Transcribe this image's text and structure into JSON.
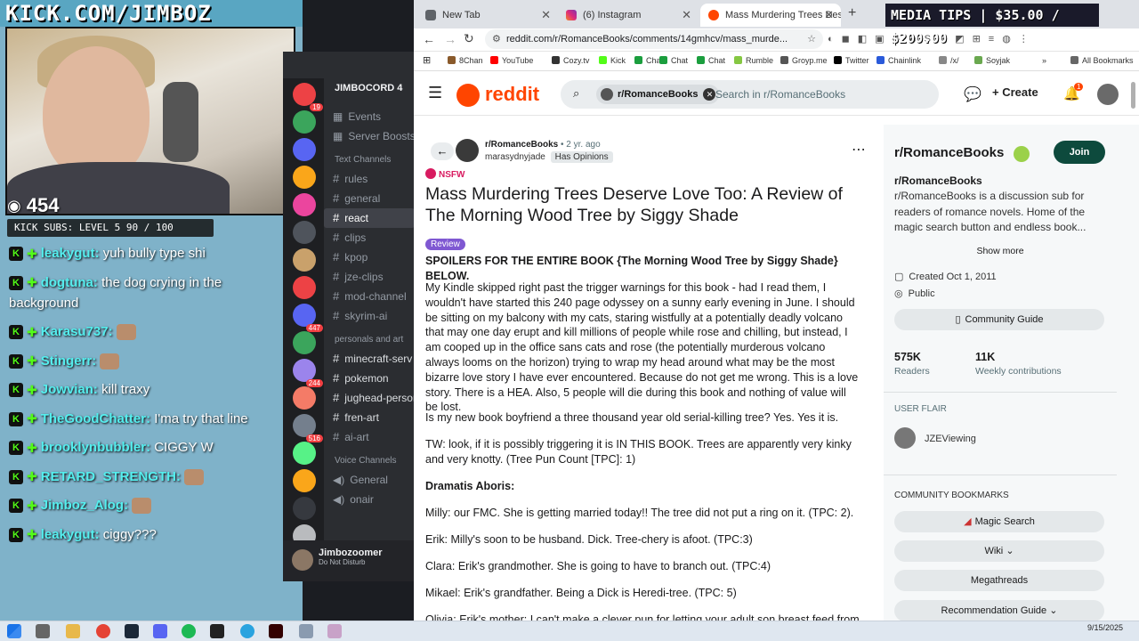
{
  "stream": {
    "url": "KICK.COM/JIMBOZ",
    "viewers": "454",
    "kick_subs": "KICK SUBS: LEVEL 5 90 / 100",
    "chat": [
      {
        "user": "leakygut:",
        "text": "yuh bully type shi"
      },
      {
        "user": "dogtuna:",
        "text": "the dog crying in the background"
      },
      {
        "user": "Karasu737:",
        "text": ""
      },
      {
        "user": "Stingerr:",
        "text": ""
      },
      {
        "user": "Jowvian:",
        "text": "kill traxy"
      },
      {
        "user": "TheGoodChatter:",
        "text": "I'ma try that line"
      },
      {
        "user": "brooklynbubbler:",
        "text": "CIGGY W"
      },
      {
        "user": "RETARD_STRENGTH:",
        "text": ""
      },
      {
        "user": "Jimboz_Alog:",
        "text": ""
      },
      {
        "user": "leakygut:",
        "text": "ciggy???"
      }
    ]
  },
  "discord": {
    "guild": "JIMBOCORD 4",
    "top_items": [
      "Events",
      "Server Boosts"
    ],
    "category_text": "Text Channels",
    "text_channels": [
      "rules",
      "general",
      "react",
      "clips",
      "kpop",
      "jze-clips",
      "mod-channel",
      "skyrim-ai"
    ],
    "active_channel": "react",
    "category_personal": "personals and art",
    "personal_channels": [
      "minecraft-serv",
      "pokemon",
      "jughead-person",
      "fren-art",
      "ai-art"
    ],
    "category_voice": "Voice Channels",
    "voice_channels": [
      "General",
      "onair"
    ],
    "server_counts": [
      "19",
      "447",
      "244",
      "516"
    ],
    "user_name": "Jimbozoomer",
    "user_status": "Do Not Disturb"
  },
  "browser": {
    "tabs": [
      {
        "label": "New Tab"
      },
      {
        "label": "(6) Instagram"
      },
      {
        "label": "Mass Murdering Trees Deserve"
      }
    ],
    "media_tips": "MEDIA TIPS | $35.00 / $200.00",
    "url": "reddit.com/r/RomanceBooks/comments/14gmhcv/mass_murde...",
    "bookmarks": [
      "8Chan",
      "YouTube",
      "Cozy.tv",
      "Kick",
      "Chat",
      "Chat",
      "Chat",
      "Rumble",
      "Groyp.me",
      "Twitter",
      "Chainlink",
      "/x/",
      "Soyjak",
      "All Bookmarks"
    ],
    "bookmark_colors": [
      "#8a5a2b",
      "#ff0000",
      "#333333",
      "#53fc18",
      "#1b9e3e",
      "#1b9e3e",
      "#1b9e3e",
      "#85c742",
      "#555555",
      "#000000",
      "#2a5ada",
      "#888888",
      "#6aa84f",
      "#666666"
    ]
  },
  "reddit": {
    "logo": "reddit",
    "search_chip": "r/RomanceBooks",
    "search_placeholder": "Search in r/RomanceBooks",
    "create": "Create",
    "notifications": "1",
    "subreddit": "r/RomanceBooks",
    "time": "• 2 yr. ago",
    "author": "marasydnyjade",
    "author_flair": "Has Opinions",
    "nsfw": "NSFW",
    "title": "Mass Murdering Trees Deserve Love Too: A Review of The Morning Wood Tree by Siggy Shade",
    "flair": "Review",
    "paragraphs": [
      "SPOILERS FOR THE ENTIRE BOOK {The Morning Wood Tree by Siggy Shade} BELOW.",
      "My Kindle skipped right past the trigger warnings for this book - had I read them, I wouldn't have started this 240 page odyssey on a sunny early evening in June. I should be sitting on my balcony with my cats, staring wistfully at a potentially deadly volcano that may one day erupt and kill millions of people while rose and chilling, but instead, I am cooped up in the office sans cats and rose (the potentially murderous volcano always looms on the horizon) trying to wrap my head around what may be the most bizarre love story I have ever encountered. Because do not get me wrong. This is a love story. There is a HEA. Also, 5 people will die during this book and nothing of value will be lost.",
      "Is my new book boyfriend a three thousand year old serial-killing tree? Yes. Yes it is.",
      "TW: look, if it is possibly triggering it is IN THIS BOOK. Trees are apparently very kinky and very knotty. (Tree Pun Count [TPC]: 1)",
      "Dramatis Aboris:",
      "Milly: our FMC. She is getting married today!! The tree did not put a ring on it. (TPC: 2).",
      "Erik: Milly's soon to be husband. Dick. Tree-chery is afoot. (TPC:3)",
      "Clara: Erik's grandmother. She is going to have to branch out. (TPC:4)",
      "Mikael: Erik's grandfather. Being a Dick is Heredi-tree. (TPC: 5)",
      "Olivia: Erik's mother: I can't make a clever pun for letting your adult son breast feed from your"
    ],
    "sidebar": {
      "name": "r/RomanceBooks",
      "join": "Join",
      "heading": "r/RomanceBooks",
      "description": "r/RomanceBooks is a discussion sub for readers of romance novels. Home of the magic search button and endless book...",
      "show_more": "Show more",
      "created": "Created Oct 1, 2011",
      "visibility": "Public",
      "guide": "Community Guide",
      "readers_value": "575K",
      "readers_label": "Readers",
      "weekly_value": "11K",
      "weekly_label": "Weekly contributions",
      "user_flair_label": "USER FLAIR",
      "user_flair_name": "JZEViewing",
      "bookmarks_label": "COMMUNITY BOOKMARKS",
      "bookmark_buttons": [
        "Magic Search",
        "Wiki",
        "Megathreads",
        "Recommendation Guide"
      ]
    }
  },
  "taskbar": {
    "date": "9/15/2025"
  },
  "colors": {
    "reddit_orange": "#ff4500",
    "join_green": "#0d4a3d",
    "kick_green": "#53fc18"
  }
}
